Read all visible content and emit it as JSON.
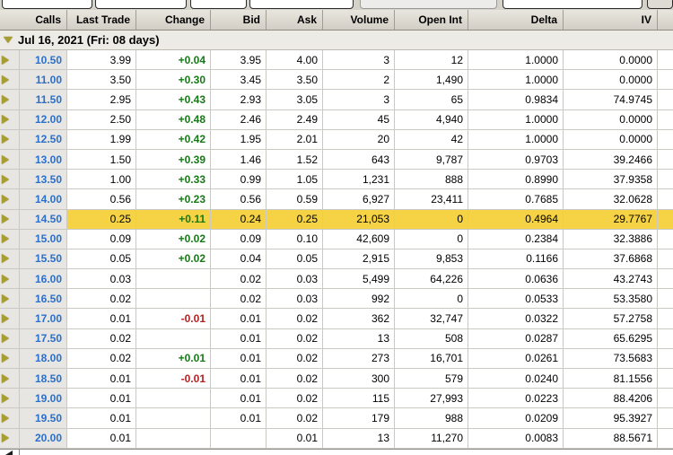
{
  "colors": {
    "highlight_row": "#f6d344",
    "strike_text": "#2a6fc9",
    "change_positive": "#157a15",
    "change_negative": "#b42020",
    "expander_icon": "#a89e2f",
    "header_bg": "#d9d5cd",
    "gray_column_bg": "#e8e6e2"
  },
  "table": {
    "columns": [
      {
        "label": "Calls"
      },
      {
        "label": "Last Trade"
      },
      {
        "label": "Change"
      },
      {
        "label": "Bid"
      },
      {
        "label": "Ask"
      },
      {
        "label": "Volume"
      },
      {
        "label": "Open Int"
      },
      {
        "label": "Delta"
      },
      {
        "label": "IV"
      }
    ],
    "group_header": "Jul 16, 2021 (Fri: 08 days)",
    "rows": [
      {
        "strike": "10.50",
        "last_trade": "3.99",
        "change": "+0.04",
        "bid": "3.95",
        "ask": "4.00",
        "volume": "3",
        "open_int": "12",
        "delta": "1.0000",
        "iv": "0.0000",
        "highlighted": false
      },
      {
        "strike": "11.00",
        "last_trade": "3.50",
        "change": "+0.30",
        "bid": "3.45",
        "ask": "3.50",
        "volume": "2",
        "open_int": "1,490",
        "delta": "1.0000",
        "iv": "0.0000",
        "highlighted": false
      },
      {
        "strike": "11.50",
        "last_trade": "2.95",
        "change": "+0.43",
        "bid": "2.93",
        "ask": "3.05",
        "volume": "3",
        "open_int": "65",
        "delta": "0.9834",
        "iv": "74.9745",
        "highlighted": false
      },
      {
        "strike": "12.00",
        "last_trade": "2.50",
        "change": "+0.48",
        "bid": "2.46",
        "ask": "2.49",
        "volume": "45",
        "open_int": "4,940",
        "delta": "1.0000",
        "iv": "0.0000",
        "highlighted": false
      },
      {
        "strike": "12.50",
        "last_trade": "1.99",
        "change": "+0.42",
        "bid": "1.95",
        "ask": "2.01",
        "volume": "20",
        "open_int": "42",
        "delta": "1.0000",
        "iv": "0.0000",
        "highlighted": false
      },
      {
        "strike": "13.00",
        "last_trade": "1.50",
        "change": "+0.39",
        "bid": "1.46",
        "ask": "1.52",
        "volume": "643",
        "open_int": "9,787",
        "delta": "0.9703",
        "iv": "39.2466",
        "highlighted": false
      },
      {
        "strike": "13.50",
        "last_trade": "1.00",
        "change": "+0.33",
        "bid": "0.99",
        "ask": "1.05",
        "volume": "1,231",
        "open_int": "888",
        "delta": "0.8990",
        "iv": "37.9358",
        "highlighted": false
      },
      {
        "strike": "14.00",
        "last_trade": "0.56",
        "change": "+0.23",
        "bid": "0.56",
        "ask": "0.59",
        "volume": "6,927",
        "open_int": "23,411",
        "delta": "0.7685",
        "iv": "32.0628",
        "highlighted": false
      },
      {
        "strike": "14.50",
        "last_trade": "0.25",
        "change": "+0.11",
        "bid": "0.24",
        "ask": "0.25",
        "volume": "21,053",
        "open_int": "0",
        "delta": "0.4964",
        "iv": "29.7767",
        "highlighted": true
      },
      {
        "strike": "15.00",
        "last_trade": "0.09",
        "change": "+0.02",
        "bid": "0.09",
        "ask": "0.10",
        "volume": "42,609",
        "open_int": "0",
        "delta": "0.2384",
        "iv": "32.3886",
        "highlighted": false
      },
      {
        "strike": "15.50",
        "last_trade": "0.05",
        "change": "+0.02",
        "bid": "0.04",
        "ask": "0.05",
        "volume": "2,915",
        "open_int": "9,853",
        "delta": "0.1166",
        "iv": "37.6868",
        "highlighted": false
      },
      {
        "strike": "16.00",
        "last_trade": "0.03",
        "change": "",
        "bid": "0.02",
        "ask": "0.03",
        "volume": "5,499",
        "open_int": "64,226",
        "delta": "0.0636",
        "iv": "43.2743",
        "highlighted": false
      },
      {
        "strike": "16.50",
        "last_trade": "0.02",
        "change": "",
        "bid": "0.02",
        "ask": "0.03",
        "volume": "992",
        "open_int": "0",
        "delta": "0.0533",
        "iv": "53.3580",
        "highlighted": false
      },
      {
        "strike": "17.00",
        "last_trade": "0.01",
        "change": "-0.01",
        "bid": "0.01",
        "ask": "0.02",
        "volume": "362",
        "open_int": "32,747",
        "delta": "0.0322",
        "iv": "57.2758",
        "highlighted": false
      },
      {
        "strike": "17.50",
        "last_trade": "0.02",
        "change": "",
        "bid": "0.01",
        "ask": "0.02",
        "volume": "13",
        "open_int": "508",
        "delta": "0.0287",
        "iv": "65.6295",
        "highlighted": false
      },
      {
        "strike": "18.00",
        "last_trade": "0.02",
        "change": "+0.01",
        "bid": "0.01",
        "ask": "0.02",
        "volume": "273",
        "open_int": "16,701",
        "delta": "0.0261",
        "iv": "73.5683",
        "highlighted": false
      },
      {
        "strike": "18.50",
        "last_trade": "0.01",
        "change": "-0.01",
        "bid": "0.01",
        "ask": "0.02",
        "volume": "300",
        "open_int": "579",
        "delta": "0.0240",
        "iv": "81.1556",
        "highlighted": false
      },
      {
        "strike": "19.00",
        "last_trade": "0.01",
        "change": "",
        "bid": "0.01",
        "ask": "0.02",
        "volume": "115",
        "open_int": "27,993",
        "delta": "0.0223",
        "iv": "88.4206",
        "highlighted": false
      },
      {
        "strike": "19.50",
        "last_trade": "0.01",
        "change": "",
        "bid": "0.01",
        "ask": "0.02",
        "volume": "179",
        "open_int": "988",
        "delta": "0.0209",
        "iv": "95.3927",
        "highlighted": false
      },
      {
        "strike": "20.00",
        "last_trade": "0.01",
        "change": "",
        "bid": "",
        "ask": "0.01",
        "volume": "13",
        "open_int": "11,270",
        "delta": "0.0083",
        "iv": "88.5671",
        "highlighted": false
      }
    ]
  }
}
